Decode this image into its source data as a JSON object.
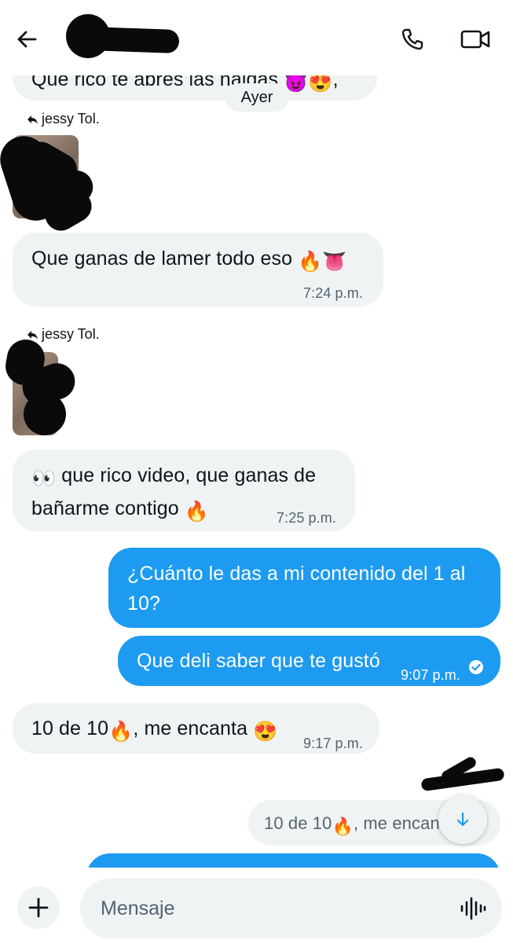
{
  "header": {
    "name": ""
  },
  "day_separator": "Ayer",
  "messages": {
    "m0": {
      "text": "Que rico te abres las nalgas",
      "emoji": "😈😍",
      "suffix": ","
    },
    "reply1": {
      "label": "jessy Tol."
    },
    "m1": {
      "text": "Que ganas de lamer todo eso",
      "emoji": "🔥👅",
      "time": "7:24 p.m."
    },
    "reply2": {
      "label": "jessy Tol."
    },
    "m2": {
      "emoji_prefix": "👀",
      "line1": "que rico video, que ganas de",
      "line2": "bañarme contigo",
      "emoji": "🔥",
      "time": "7:25 p.m."
    },
    "m3": {
      "line1": "¿Cuánto le das a mi contenido del 1 al",
      "line2": "10?"
    },
    "m4": {
      "text": "Que deli saber que te gustó",
      "time": "9:07 p.m."
    },
    "m5": {
      "prefix": "10 de 10",
      "emoji": "🔥",
      "text": ", me encanta",
      "emoji2": "😍",
      "time": "9:17 p.m."
    },
    "m6": {
      "prefix": "10 de 10",
      "emoji": "🔥",
      "text": ", me encan"
    }
  },
  "composer": {
    "placeholder": "Mensaje"
  },
  "colors": {
    "accent": "#1d9bf0",
    "incoming": "#eff3f4",
    "muted": "#536471"
  },
  "icons": {
    "back": "arrow-left-icon",
    "call": "phone-icon",
    "video": "video-camera-icon",
    "reply": "reply-arrow-icon",
    "read": "check-circle-icon",
    "scroll": "arrow-down-icon",
    "add": "plus-icon",
    "voice": "voice-wave-icon"
  }
}
